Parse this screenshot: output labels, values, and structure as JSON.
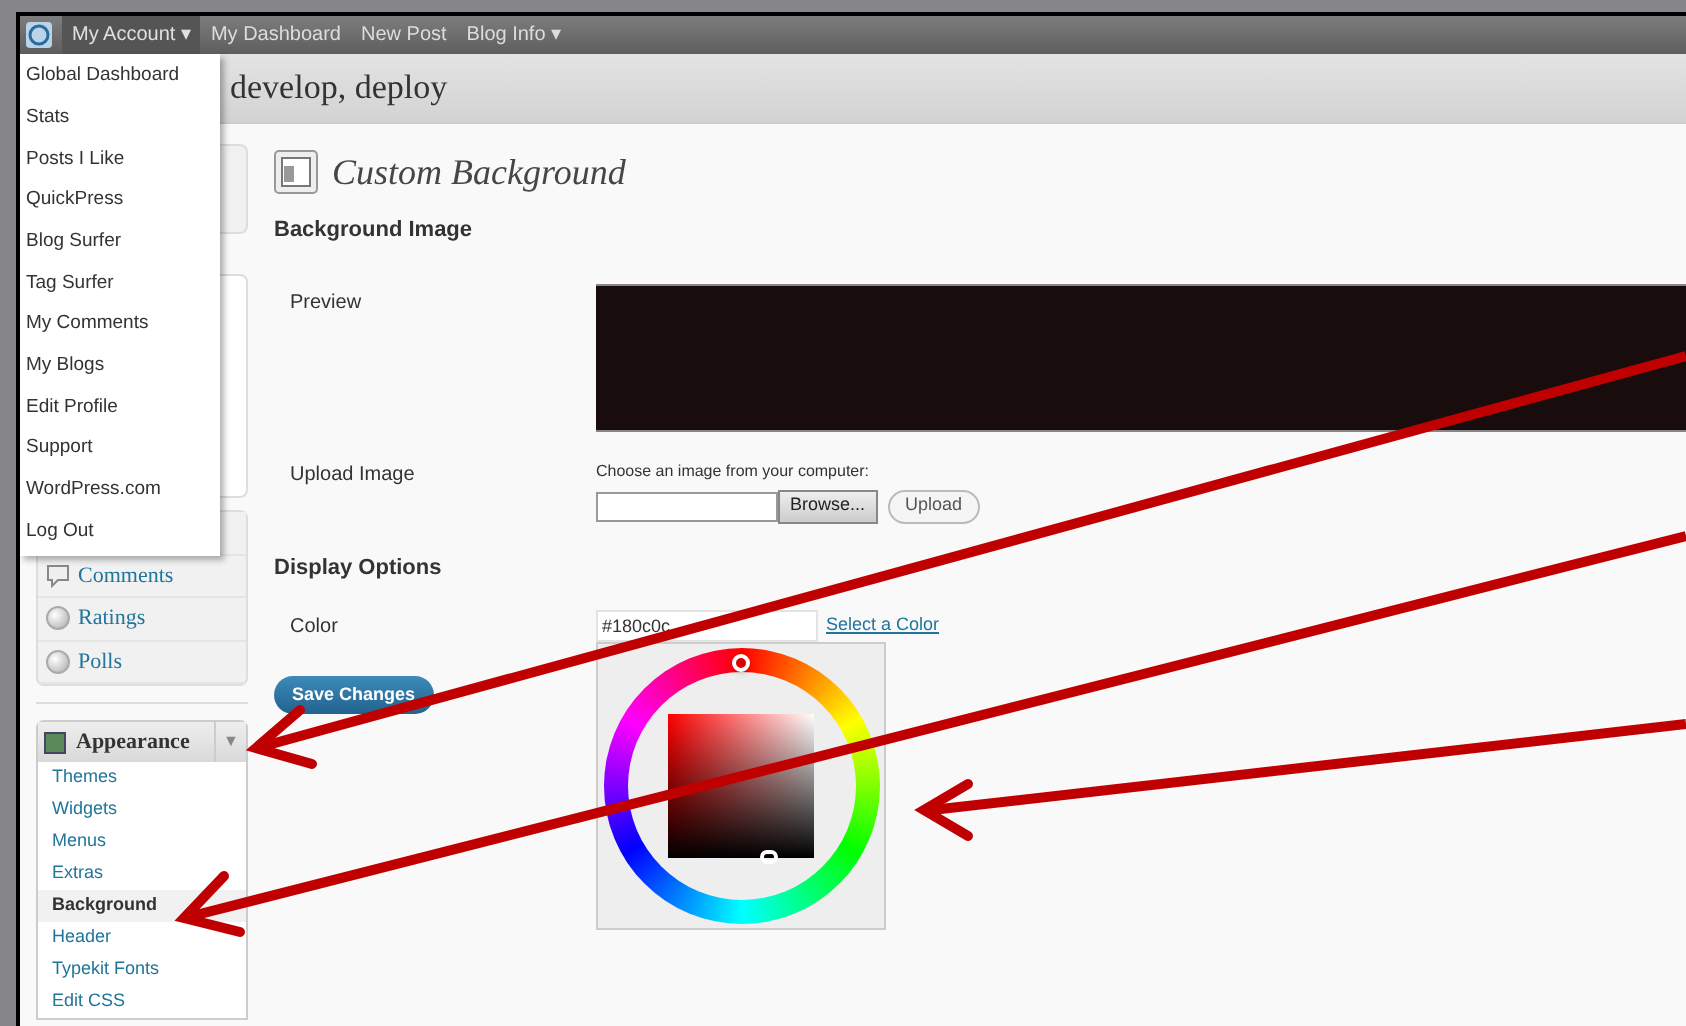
{
  "admin_bar": {
    "items": [
      {
        "label": "My Account ▾",
        "selected": true
      },
      {
        "label": "My Dashboard",
        "selected": false
      },
      {
        "label": "New Post",
        "selected": false
      },
      {
        "label": "Blog Info ▾",
        "selected": false
      }
    ]
  },
  "account_menu": [
    "Global Dashboard",
    "Stats",
    "Posts I Like",
    "QuickPress",
    "Blog Surfer",
    "Tag Surfer",
    "My Comments",
    "My Blogs",
    "Edit Profile",
    "Support",
    "WordPress.com",
    "Log Out"
  ],
  "site_title": "develop, deploy",
  "sidebar": {
    "items": [
      {
        "label": "Comments",
        "kind": "comment"
      },
      {
        "label": "Ratings",
        "kind": "circle"
      },
      {
        "label": "Polls",
        "kind": "circle"
      }
    ],
    "appearance": {
      "label": "Appearance",
      "toggle": "▼",
      "expanded": true,
      "children": [
        {
          "label": "Themes",
          "selected": false
        },
        {
          "label": "Widgets",
          "selected": false
        },
        {
          "label": "Menus",
          "selected": false
        },
        {
          "label": "Extras",
          "selected": false
        },
        {
          "label": "Background",
          "selected": true
        },
        {
          "label": "Header",
          "selected": false
        },
        {
          "label": "Typekit Fonts",
          "selected": false
        },
        {
          "label": "Edit CSS",
          "selected": false
        }
      ]
    }
  },
  "page_title": "Custom Background",
  "background_image": {
    "heading": "Background Image",
    "preview_label": "Preview",
    "upload_label": "Upload Image",
    "upload_hint": "Choose an image from your computer:",
    "browse_button": "Browse...",
    "upload_button": "Upload"
  },
  "display_options": {
    "heading": "Display Options",
    "color_label": "Color",
    "color_value": "#180c0c",
    "select_link": "Select a Color"
  },
  "save_button": "Save Changes"
}
